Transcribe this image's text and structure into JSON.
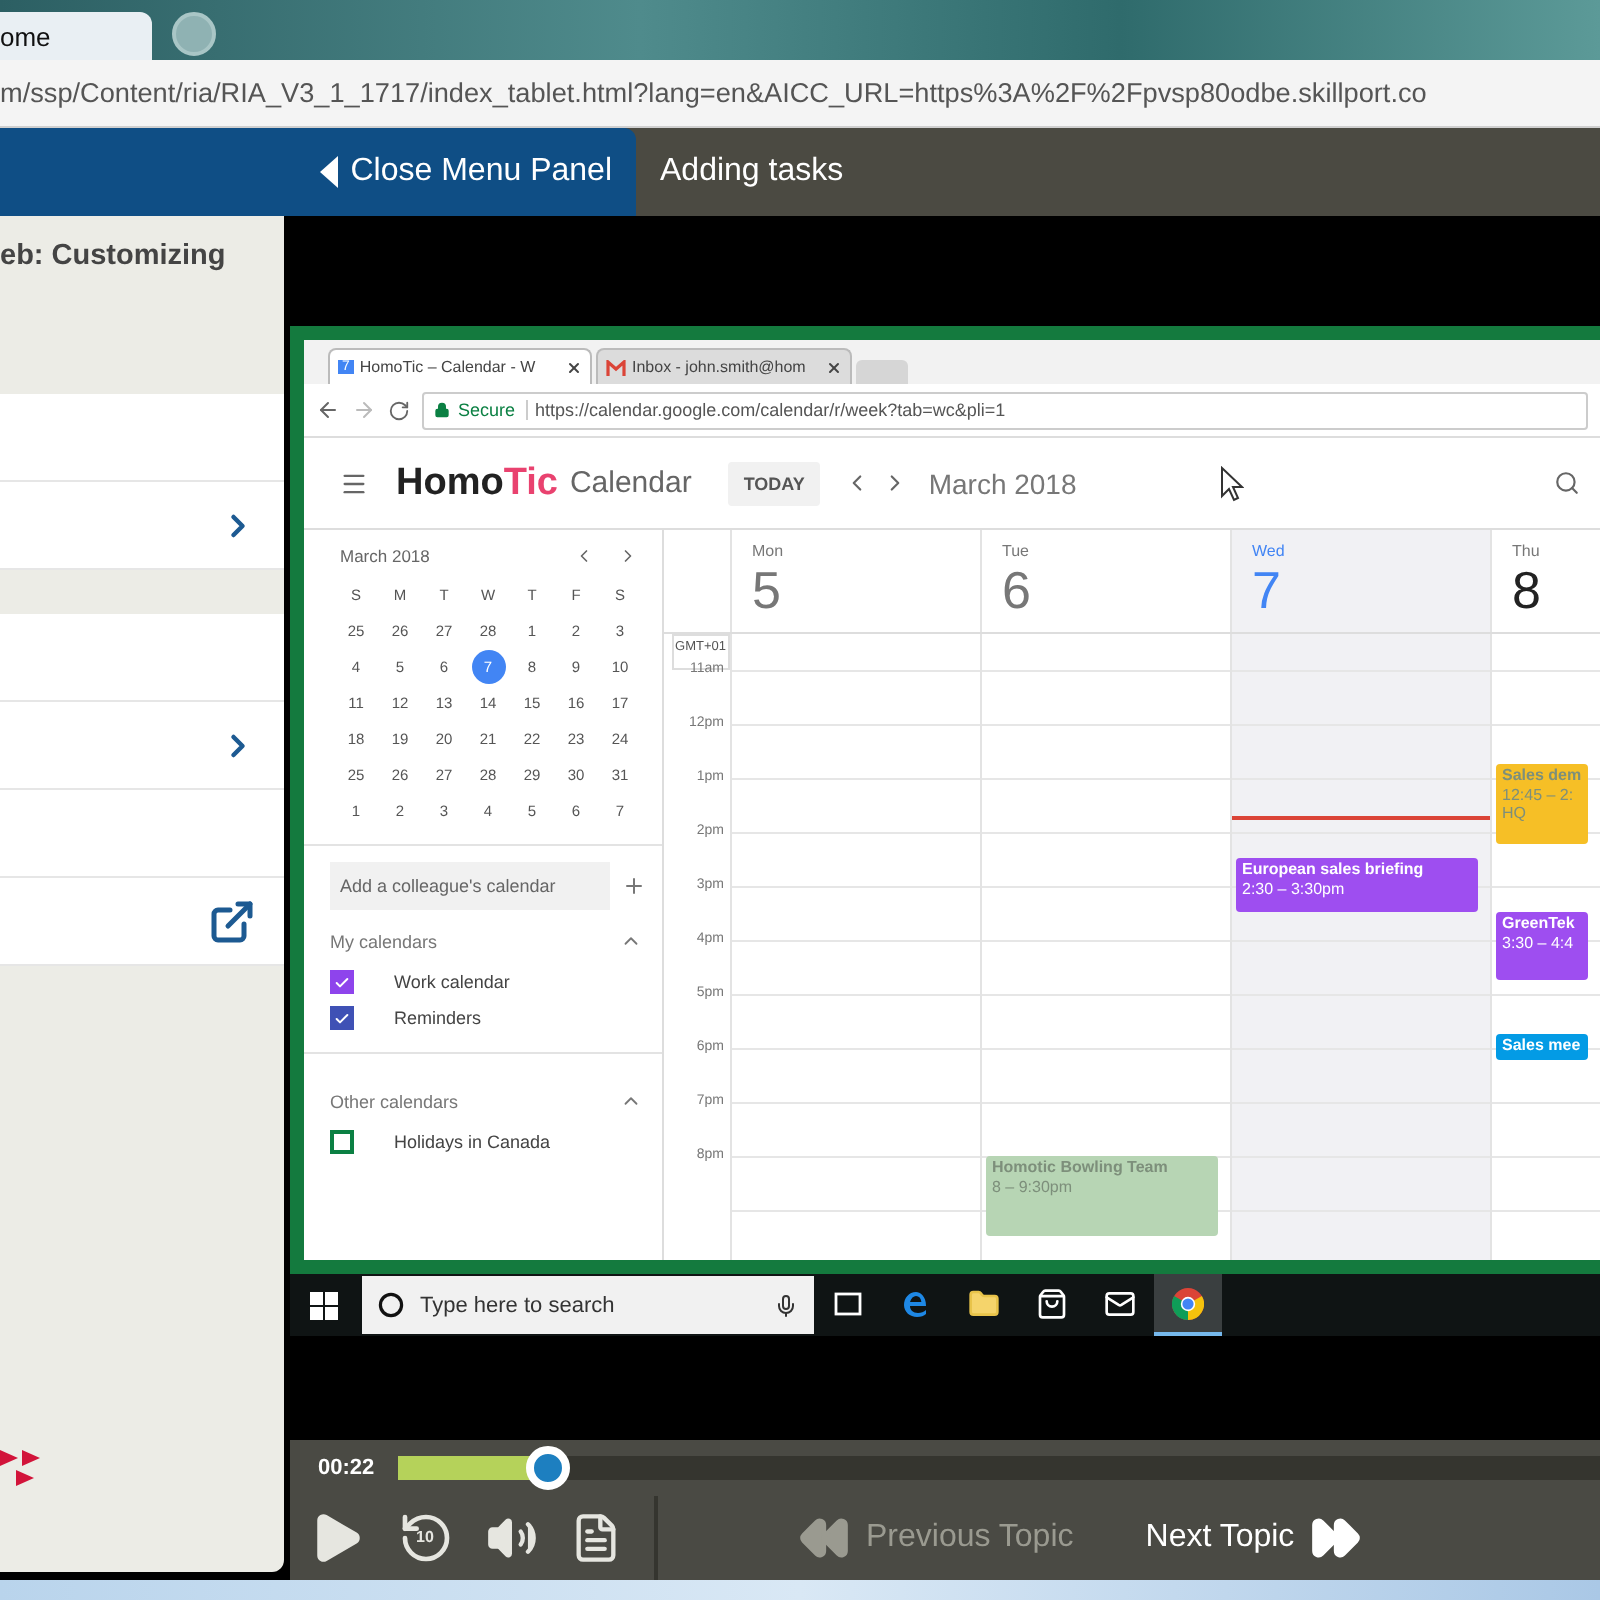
{
  "browser": {
    "tab_title": "ome",
    "url": "m/ssp/Content/ria/RIA_V3_1_1717/index_tablet.html?lang=en&AICC_URL=https%3A%2F%2Fpvsp80odbe.skillport.co"
  },
  "header": {
    "close_panel": "Close Menu Panel",
    "title": "Adding tasks"
  },
  "menu_panel": {
    "title": "eb: Customizing",
    "groups": [
      {
        "items": [
          {
            "kind": "plain"
          },
          {
            "kind": "submenu"
          }
        ]
      },
      {
        "items": [
          {
            "kind": "plain"
          },
          {
            "kind": "submenu"
          },
          {
            "kind": "plain"
          },
          {
            "kind": "external"
          }
        ]
      }
    ]
  },
  "video": {
    "browser": {
      "tabs": [
        {
          "kind": "calendar",
          "badge": "7",
          "title": "HomoTic – Calendar - W",
          "selected": true
        },
        {
          "kind": "mail",
          "title": "Inbox - john.smith@hom",
          "selected": false
        }
      ],
      "secure_label": "Secure",
      "url": "https://calendar.google.com/calendar/r/week?tab=wc&pli=1"
    },
    "calendar_app": {
      "logo": [
        "Homo",
        "Tic"
      ],
      "product": "Calendar",
      "today_button": "TODAY",
      "period": "March 2018",
      "mini_calendar": {
        "month": "March 2018",
        "weekdays": [
          "S",
          "M",
          "T",
          "W",
          "T",
          "F",
          "S"
        ],
        "weeks": [
          [
            {
              "day": "25",
              "selected": false
            },
            {
              "day": "26",
              "selected": false
            },
            {
              "day": "27",
              "selected": false
            },
            {
              "day": "28",
              "selected": false
            },
            {
              "day": "1",
              "selected": false
            },
            {
              "day": "2",
              "selected": false
            },
            {
              "day": "3",
              "selected": false
            }
          ],
          [
            {
              "day": "4",
              "selected": false
            },
            {
              "day": "5",
              "selected": false
            },
            {
              "day": "6",
              "selected": false
            },
            {
              "day": "7",
              "selected": true
            },
            {
              "day": "8",
              "selected": false
            },
            {
              "day": "9",
              "selected": false
            },
            {
              "day": "10",
              "selected": false
            }
          ],
          [
            {
              "day": "11",
              "selected": false
            },
            {
              "day": "12",
              "selected": false
            },
            {
              "day": "13",
              "selected": false
            },
            {
              "day": "14",
              "selected": false
            },
            {
              "day": "15",
              "selected": false
            },
            {
              "day": "16",
              "selected": false
            },
            {
              "day": "17",
              "selected": false
            }
          ],
          [
            {
              "day": "18",
              "selected": false
            },
            {
              "day": "19",
              "selected": false
            },
            {
              "day": "20",
              "selected": false
            },
            {
              "day": "21",
              "selected": false
            },
            {
              "day": "22",
              "selected": false
            },
            {
              "day": "23",
              "selected": false
            },
            {
              "day": "24",
              "selected": false
            }
          ],
          [
            {
              "day": "25",
              "selected": false
            },
            {
              "day": "26",
              "selected": false
            },
            {
              "day": "27",
              "selected": false
            },
            {
              "day": "28",
              "selected": false
            },
            {
              "day": "29",
              "selected": false
            },
            {
              "day": "30",
              "selected": false
            },
            {
              "day": "31",
              "selected": false
            }
          ],
          [
            {
              "day": "1",
              "selected": false
            },
            {
              "day": "2",
              "selected": false
            },
            {
              "day": "3",
              "selected": false
            },
            {
              "day": "4",
              "selected": false
            },
            {
              "day": "5",
              "selected": false
            },
            {
              "day": "6",
              "selected": false
            },
            {
              "day": "7",
              "selected": false
            }
          ]
        ]
      },
      "add_calendar_placeholder": "Add a colleague's calendar",
      "calendar_groups": [
        {
          "title": "My calendars",
          "expanded": true,
          "calendars": [
            {
              "name": "Work calendar",
              "checked": true,
              "color": "#8e44ec"
            },
            {
              "name": "Reminders",
              "checked": true,
              "color": "#3f51b5"
            }
          ]
        },
        {
          "title": "Other calendars",
          "expanded": true,
          "calendars": [
            {
              "name": "Holidays in Canada",
              "checked": false,
              "color": "#0b8043"
            }
          ]
        }
      ],
      "timezone": "GMT+01",
      "hours": [
        "11am",
        "12pm",
        "1pm",
        "2pm",
        "3pm",
        "4pm",
        "5pm",
        "6pm",
        "7pm",
        "8pm"
      ],
      "days": [
        {
          "name": "Mon",
          "number": "5",
          "today": false
        },
        {
          "name": "Tue",
          "number": "6",
          "today": false,
          "events": [
            {
              "title": "Homotic Bowling Team",
              "time": "8 – 9:30pm",
              "color": "#b7d5b4"
            }
          ]
        },
        {
          "name": "Wed",
          "number": "7",
          "today": true,
          "events": [
            {
              "title": "European sales briefing",
              "time": "2:30 – 3:30pm",
              "color": "#9e4ef0"
            }
          ]
        },
        {
          "name": "Thu",
          "number": "8",
          "today": false,
          "events": [
            {
              "title": "Sales dem",
              "time": "12:45 – 2:",
              "place": "HQ",
              "color": "#f6bf26"
            },
            {
              "title": "GreenTek",
              "time": "3:30 – 4:4",
              "color": "#9e4ef0"
            },
            {
              "title": "Sales mee",
              "color": "#039be5"
            }
          ]
        }
      ]
    },
    "taskbar": {
      "search_placeholder": "Type here to search",
      "apps": [
        {
          "kind": "task-view",
          "selected": false
        },
        {
          "kind": "edge",
          "selected": false
        },
        {
          "kind": "folder",
          "selected": false
        },
        {
          "kind": "store",
          "selected": false
        },
        {
          "kind": "mail",
          "selected": false
        },
        {
          "kind": "chrome",
          "selected": true
        }
      ]
    }
  },
  "player": {
    "time": "00:22",
    "level": 0.11,
    "replay_label": "10",
    "previous": {
      "label": "Previous Topic",
      "disabled": true
    },
    "next": {
      "label": "Next Topic",
      "disabled": false
    }
  }
}
